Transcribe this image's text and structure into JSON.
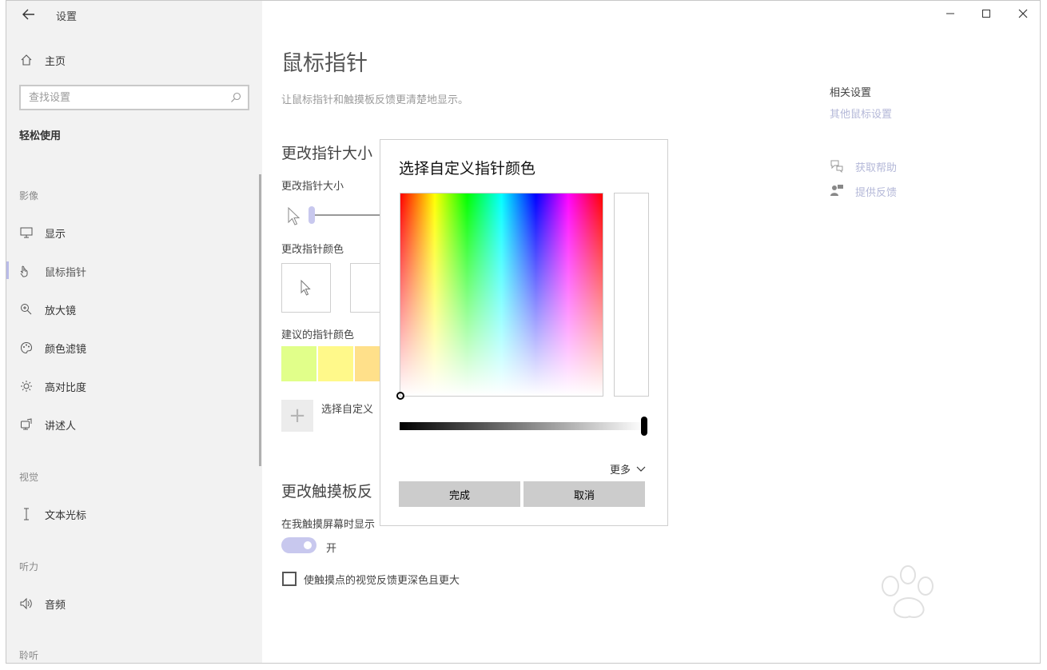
{
  "window": {
    "title": "设置",
    "controls": {
      "minimize": "minimize-icon",
      "maximize": "maximize-icon",
      "close": "close-icon"
    }
  },
  "sidebar": {
    "home": "主页",
    "search_placeholder": "查找设置",
    "section": "轻松使用",
    "groups": {
      "vision": "影像",
      "vision2": "视觉",
      "hearing": "听力",
      "listen": "聆听"
    },
    "items": [
      {
        "label": "显示",
        "icon": "monitor-icon"
      },
      {
        "label": "鼠标指针",
        "icon": "mouse-pointer-icon",
        "active": true
      },
      {
        "label": "放大镜",
        "icon": "magnifier-icon"
      },
      {
        "label": "颜色滤镜",
        "icon": "palette-icon"
      },
      {
        "label": "高对比度",
        "icon": "brightness-icon"
      },
      {
        "label": "讲述人",
        "icon": "narrator-icon"
      },
      {
        "label": "文本光标",
        "icon": "text-cursor-icon"
      },
      {
        "label": "音频",
        "icon": "speaker-icon"
      }
    ]
  },
  "main": {
    "title": "鼠标指针",
    "description": "让鼠标指针和触摸板反馈更清楚地显示。",
    "size_heading": "更改指针大小",
    "size_label": "更改指针大小",
    "color_label": "更改指针颜色",
    "suggested_label": "建议的指针颜色",
    "suggested_colors": [
      "#e1ff8a",
      "#fff98a",
      "#ffe08a"
    ],
    "custom_label": "选择自定义",
    "touch_heading": "更改触摸板反",
    "touch_desc": "在我触摸屏幕时显示",
    "toggle_state": "开",
    "checkbox_label": "使触摸点的视觉反馈更深色且更大"
  },
  "related": {
    "title": "相关设置",
    "other_mouse": "其他鼠标设置",
    "help": "获取帮助",
    "feedback": "提供反馈"
  },
  "dialog": {
    "title": "选择自定义指针颜色",
    "more": "更多",
    "done": "完成",
    "cancel": "取消",
    "brightness_value": 1.0
  }
}
